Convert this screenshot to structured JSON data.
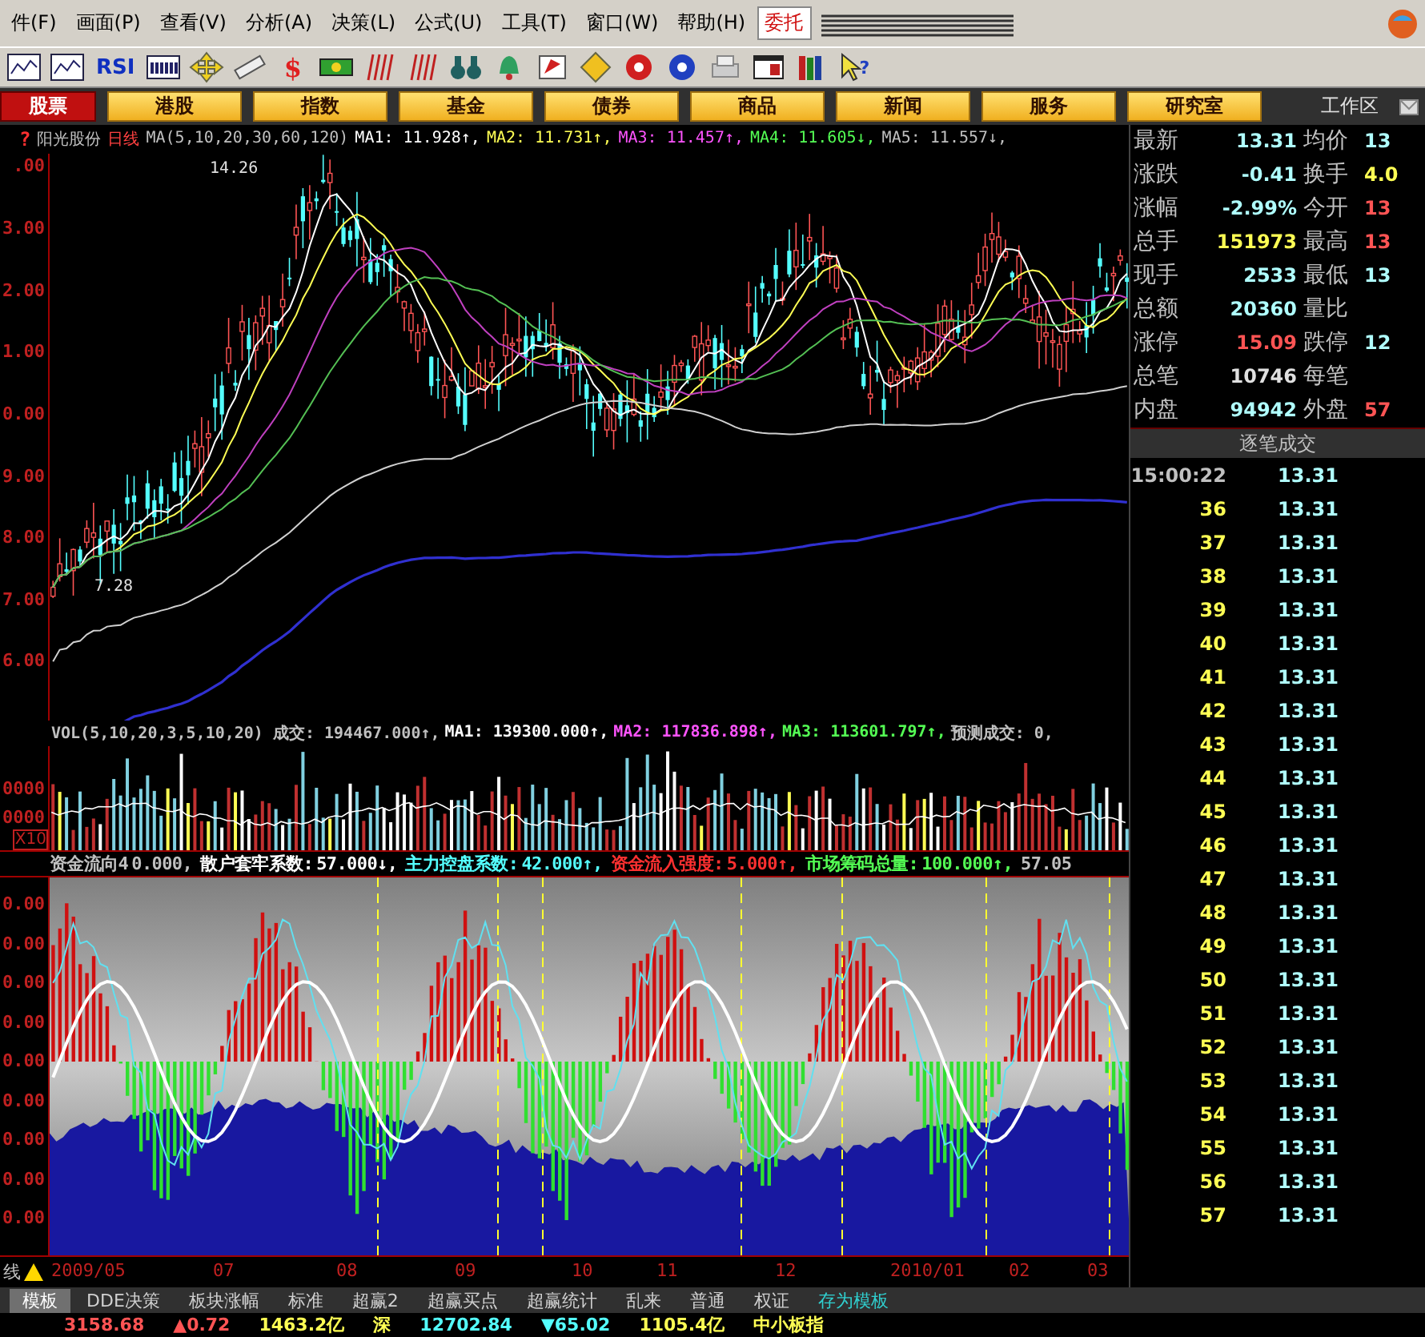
{
  "menu": {
    "items": [
      "件(F)",
      "画面(P)",
      "查看(V)",
      "分析(A)",
      "决策(L)",
      "公式(U)",
      "工具(T)",
      "窗口(W)",
      "帮助(H)"
    ],
    "trade_button": "委托"
  },
  "toolbar": {
    "text_button": "RSI",
    "dollar_glyph": "$",
    "help_glyph": "?"
  },
  "categories": [
    {
      "label": "股票",
      "selected": true
    },
    {
      "label": "港股",
      "selected": false
    },
    {
      "label": "指数",
      "selected": false
    },
    {
      "label": "基金",
      "selected": false
    },
    {
      "label": "债券",
      "selected": false
    },
    {
      "label": "商品",
      "selected": false
    },
    {
      "label": "新闻",
      "selected": false
    },
    {
      "label": "服务",
      "selected": false
    },
    {
      "label": "研究室",
      "selected": false
    }
  ],
  "workspace_label": "工作区",
  "price_chart": {
    "help_mark": "?",
    "header": [
      {
        "text": "阳光股份",
        "color": "#c0c0c0"
      },
      {
        "text": "日线",
        "color": "#ff4040"
      },
      {
        "text": "MA(5,10,20,30,60,120)",
        "color": "#c0c0c0"
      },
      {
        "text": "MA1: 11.928↑,",
        "color": "#ffffff"
      },
      {
        "text": "MA2: 11.731↑,",
        "color": "#ffff54"
      },
      {
        "text": "MA3: 11.457↑,",
        "color": "#ff54ff"
      },
      {
        "text": "MA4: 11.605↓,",
        "color": "#54ff54"
      },
      {
        "text": "MA5: 11.557↓,",
        "color": "#c0c0c0"
      }
    ],
    "y_labels": [
      ".00",
      "3.00",
      "2.00",
      "1.00",
      "0.00",
      "9.00",
      "8.00",
      "7.00",
      "6.00"
    ],
    "high_label": "14.26",
    "low_label": "7.28"
  },
  "volume_chart": {
    "header": [
      {
        "text": "VOL(5,10,20,3,5,10,20) 成交: 194467.000↑,",
        "color": "#c0c0c0"
      },
      {
        "text": "MA1: 139300.000↑,",
        "color": "#ffffff"
      },
      {
        "text": "MA2: 117836.898↑,",
        "color": "#ff54ff"
      },
      {
        "text": "MA3: 113601.797↑,",
        "color": "#54ff54"
      },
      {
        "text": "预测成交: 0,",
        "color": "#c0c0c0"
      }
    ],
    "y_labels": [
      "0000",
      "0000"
    ],
    "unit": "X10"
  },
  "indicator_chart": {
    "header": [
      {
        "label": "资金流向4",
        "value": "0.000,",
        "color": "#c0c0c0"
      },
      {
        "label": "散户套牢系数:",
        "value": "57.000↓,",
        "color": "#ffffff"
      },
      {
        "label": "主力控盘系数:",
        "value": "42.000↑,",
        "color": "#54ffff"
      },
      {
        "label": "资金流入强度:",
        "value": "5.000↑,",
        "color": "#ff3030"
      },
      {
        "label": "市场筹码总量:",
        "value": "100.000↑,",
        "color": "#54ff54"
      },
      {
        "value": "57.05",
        "color": "#c0c0c0"
      }
    ],
    "y_labels": [
      "0.00",
      "0.00",
      "0.00",
      "0.00",
      "0.00",
      "0.00",
      "0.00",
      "0.00",
      "0.00"
    ]
  },
  "date_axis": {
    "corner": "线",
    "labels": [
      "2009/05",
      "07",
      "08",
      "09",
      "10",
      "11",
      "12",
      "2010/01",
      "02",
      "03"
    ]
  },
  "template_tabs": [
    {
      "label": "模板",
      "selected": true
    },
    {
      "label": "DDE决策",
      "selected": false
    },
    {
      "label": "板块涨幅",
      "selected": false
    },
    {
      "label": "标准",
      "selected": false
    },
    {
      "label": "超赢2",
      "selected": false
    },
    {
      "label": "超赢买点",
      "selected": false
    },
    {
      "label": "超赢统计",
      "selected": false
    },
    {
      "label": "乱来",
      "selected": false
    },
    {
      "label": "普通",
      "selected": false
    },
    {
      "label": "权证",
      "selected": false
    },
    {
      "label": "存为模板",
      "selected": false
    }
  ],
  "status_bar": [
    {
      "text": "3158.68",
      "color": "#ff5454"
    },
    {
      "text": "▲0.72",
      "color": "#ff5454"
    },
    {
      "text": "1463.2亿",
      "color": "#ffff54"
    },
    {
      "text": "深",
      "color": "#ffff54"
    },
    {
      "text": "12702.84",
      "color": "#54ffff"
    },
    {
      "text": "▼65.02",
      "color": "#54ffff"
    },
    {
      "text": "1105.4亿",
      "color": "#ffff54"
    },
    {
      "text": "中小板指",
      "color": "#ffff54"
    }
  ],
  "quote": [
    {
      "left": {
        "label": "最新",
        "value": "13.31",
        "color": "#b0ffff"
      },
      "right": {
        "label": "均价",
        "value": "13",
        "color": "#b0ffff"
      }
    },
    {
      "left": {
        "label": "涨跌",
        "value": "-0.41",
        "color": "#b0ffff"
      },
      "right": {
        "label": "换手",
        "value": "4.0",
        "color": "#ffff54"
      }
    },
    {
      "left": {
        "label": "涨幅",
        "value": "-2.99%",
        "color": "#b0ffff"
      },
      "right": {
        "label": "今开",
        "value": "13",
        "color": "#ff5454"
      }
    },
    {
      "left": {
        "label": "总手",
        "value": "151973",
        "color": "#ffff54"
      },
      "right": {
        "label": "最高",
        "value": "13",
        "color": "#ff5454"
      }
    },
    {
      "left": {
        "label": "现手",
        "value": "2533",
        "color": "#b0ffff"
      },
      "right": {
        "label": "最低",
        "value": "13",
        "color": "#b0ffff"
      }
    },
    {
      "left": {
        "label": "总额",
        "value": "20360",
        "color": "#b0ffff"
      },
      "right": {
        "label": "量比"
      }
    },
    {
      "left": {
        "label": "涨停",
        "value": "15.09",
        "color": "#ff5454"
      },
      "right": {
        "label": "跌停",
        "value": "12",
        "color": "#b0ffff"
      }
    },
    {
      "left": {
        "label": "总笔",
        "value": "10746",
        "color": "#e0e0e0"
      },
      "right": {
        "label": "每笔"
      }
    },
    {
      "left": {
        "label": "内盘",
        "value": "94942",
        "color": "#b0ffff"
      },
      "right": {
        "label": "外盘",
        "value": "57",
        "color": "#ff5454"
      }
    }
  ],
  "ticks_title": "逐笔成交",
  "ticks": [
    {
      "kind": "time",
      "time": "15:00:22",
      "price": "13.31"
    },
    {
      "kind": "seq",
      "time": "36",
      "price": "13.31"
    },
    {
      "kind": "seq",
      "time": "37",
      "price": "13.31"
    },
    {
      "kind": "seq",
      "time": "38",
      "price": "13.31"
    },
    {
      "kind": "seq",
      "time": "39",
      "price": "13.31"
    },
    {
      "kind": "seq",
      "time": "40",
      "price": "13.31"
    },
    {
      "kind": "seq",
      "time": "41",
      "price": "13.31"
    },
    {
      "kind": "seq",
      "time": "42",
      "price": "13.31"
    },
    {
      "kind": "seq",
      "time": "43",
      "price": "13.31"
    },
    {
      "kind": "seq",
      "time": "44",
      "price": "13.31"
    },
    {
      "kind": "seq",
      "time": "45",
      "price": "13.31"
    },
    {
      "kind": "seq",
      "time": "46",
      "price": "13.31"
    },
    {
      "kind": "seq",
      "time": "47",
      "price": "13.31"
    },
    {
      "kind": "seq",
      "time": "48",
      "price": "13.31"
    },
    {
      "kind": "seq",
      "time": "49",
      "price": "13.31"
    },
    {
      "kind": "seq",
      "time": "50",
      "price": "13.31"
    },
    {
      "kind": "seq",
      "time": "51",
      "price": "13.31"
    },
    {
      "kind": "seq",
      "time": "52",
      "price": "13.31"
    },
    {
      "kind": "seq",
      "time": "53",
      "price": "13.31"
    },
    {
      "kind": "seq",
      "time": "54",
      "price": "13.31"
    },
    {
      "kind": "seq",
      "time": "55",
      "price": "13.31"
    },
    {
      "kind": "seq",
      "time": "56",
      "price": "13.31"
    },
    {
      "kind": "seq",
      "time": "57",
      "price": "13.31"
    }
  ]
}
